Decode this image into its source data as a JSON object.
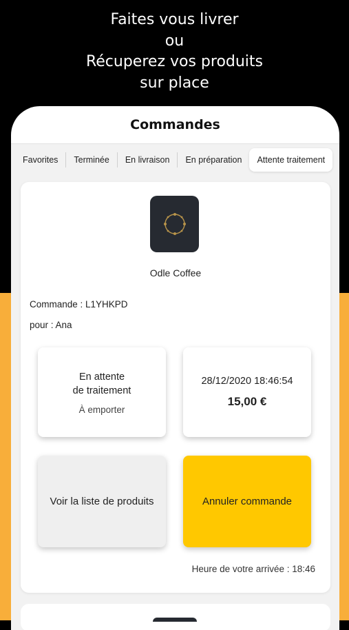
{
  "headline": {
    "line1": "Faites vous livrer",
    "line2": "ou",
    "line3": "Récuperez vos produits",
    "line4": "sur place"
  },
  "colors": {
    "background_top": "#000000",
    "background_bottom": "#f8ae3a",
    "accent_button": "#ffc800",
    "logo_bg": "#262a31"
  },
  "header": {
    "title": "Commandes"
  },
  "tabs": [
    {
      "label": "Favorites"
    },
    {
      "label": "Terminée"
    },
    {
      "label": "En livraison"
    },
    {
      "label": "En préparation"
    },
    {
      "label": "Attente traitement",
      "active": true
    }
  ],
  "order": {
    "shop_logo_icon": "coffee-ring-icon",
    "shop_name": "Odle Coffee",
    "order_label": "Commande : L1YHKPD",
    "for_label": "pour : Ana",
    "status_line1": "En attente",
    "status_line2": "de traitement",
    "order_type": "À emporter",
    "date": "28/12/2020 18:46:54",
    "price": "15,00 €",
    "view_products_label": "Voir la liste de produits",
    "cancel_label": "Annuler commande",
    "arrival": "Heure de votre arrivée : 18:46"
  }
}
